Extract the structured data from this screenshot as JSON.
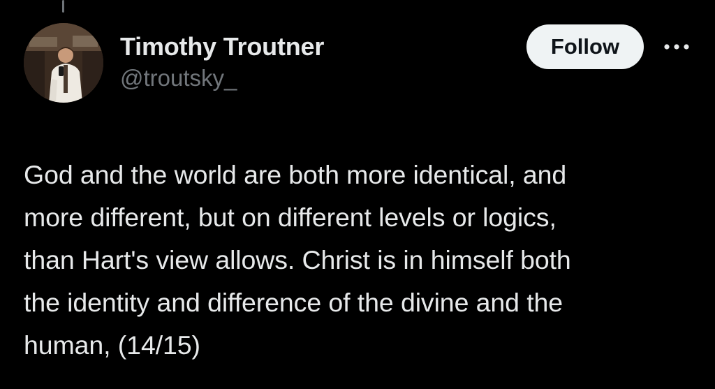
{
  "author": {
    "display_name": "Timothy Troutner",
    "handle": "@troutsky_",
    "avatar_icon": "profile-photo"
  },
  "actions": {
    "follow_label": "Follow",
    "more_icon": "more-horizontal-icon"
  },
  "post": {
    "lines": [
      "God and the world are both more identical, and",
      "more different, but on different levels or logics,",
      "than Hart's view allows. Christ is in himself both",
      "the identity and difference of the divine and the",
      "human, (14/15)"
    ]
  },
  "colors": {
    "background": "#000000",
    "primary_text": "#e7e9ea",
    "secondary_text": "#71767b",
    "follow_bg": "#eff3f4",
    "follow_text": "#0f1419"
  }
}
